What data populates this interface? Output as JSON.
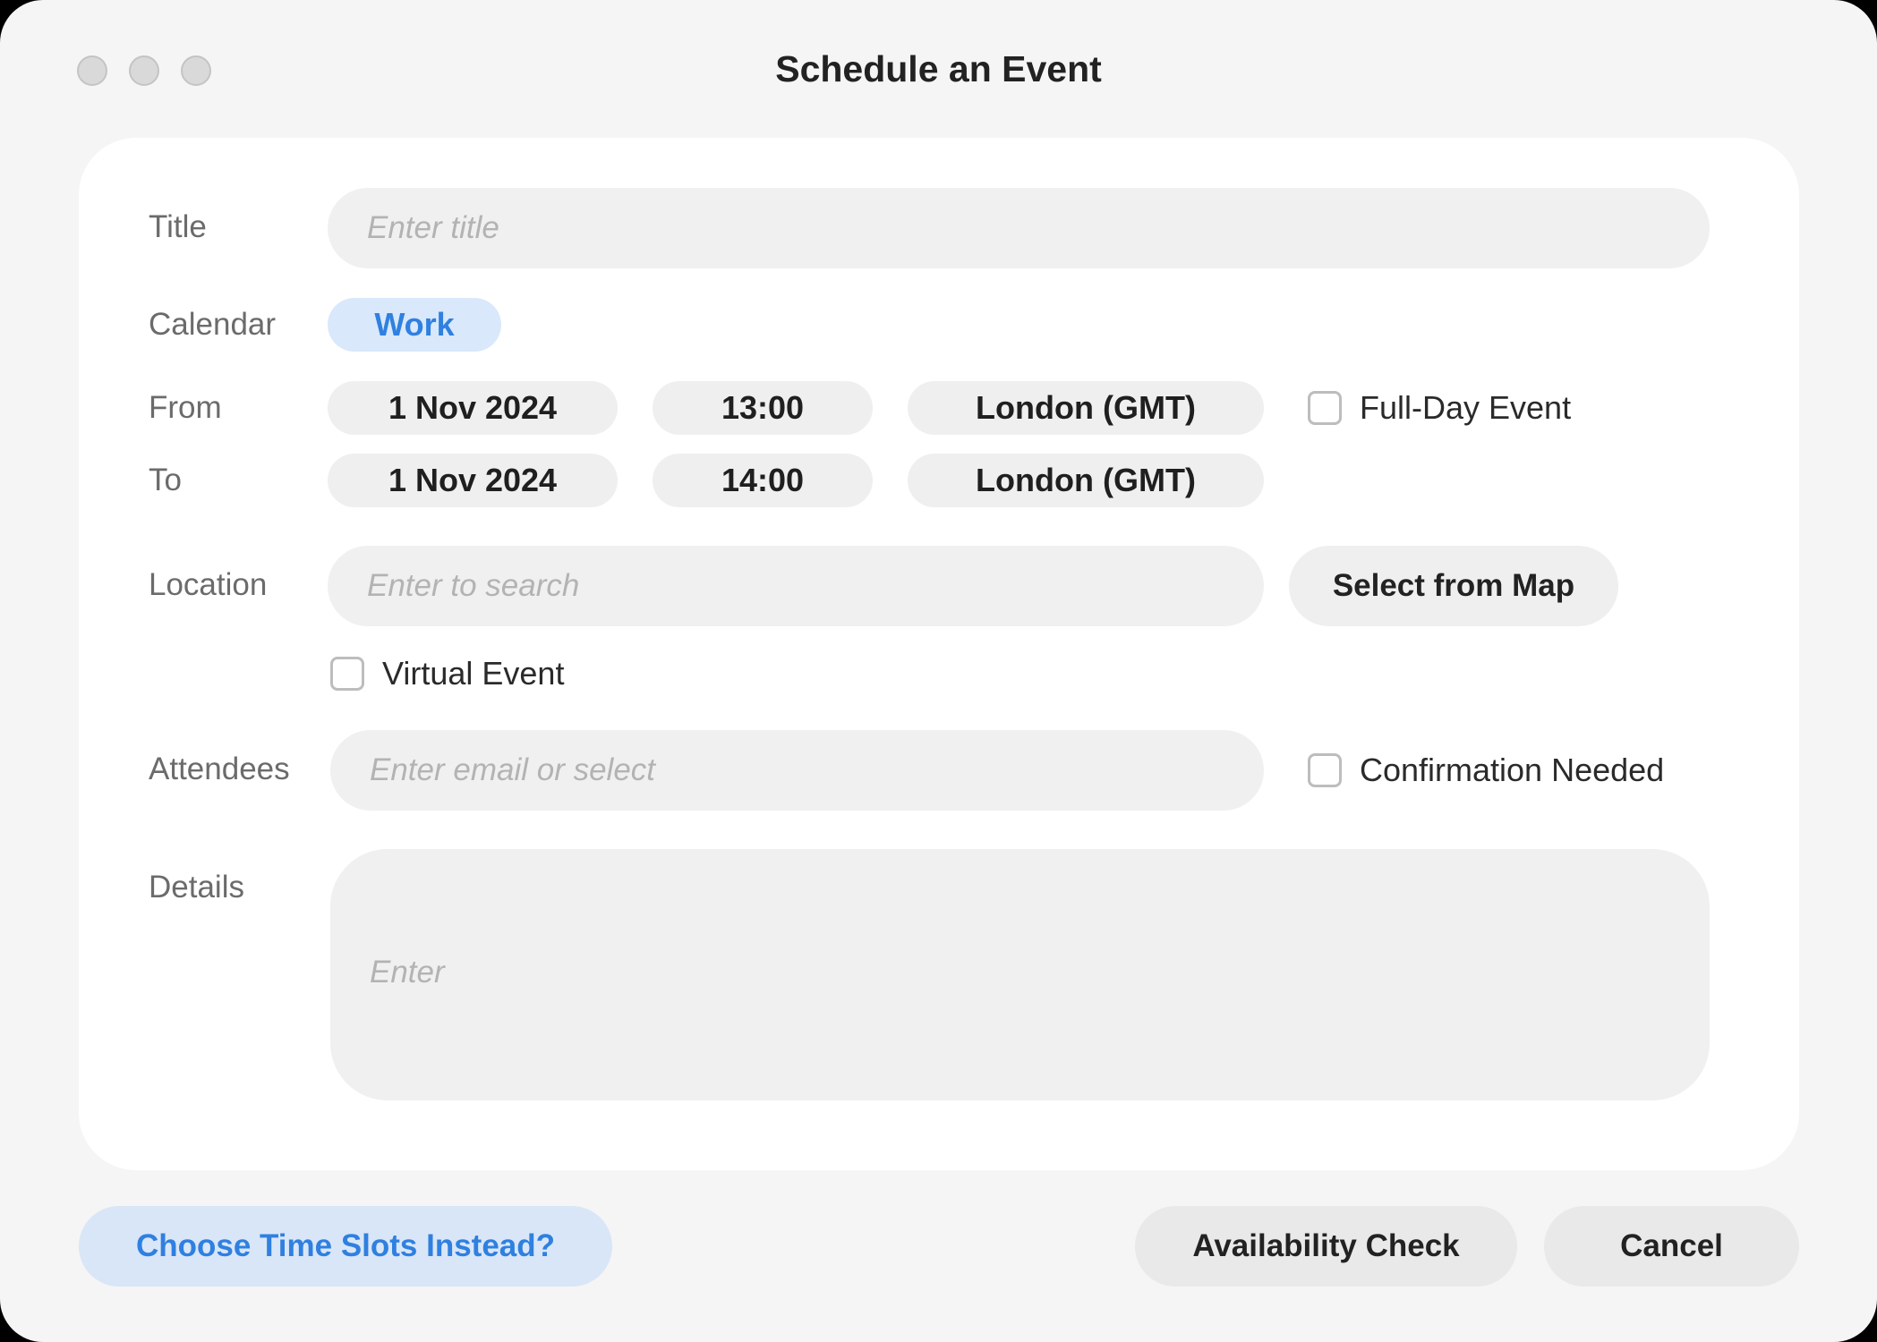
{
  "window": {
    "title": "Schedule an Event"
  },
  "form": {
    "title": {
      "label": "Title",
      "placeholder": "Enter title"
    },
    "calendar": {
      "label": "Calendar",
      "value": "Work"
    },
    "from": {
      "label": "From",
      "date": "1 Nov 2024",
      "time": "13:00",
      "timezone": "London (GMT)"
    },
    "to": {
      "label": "To",
      "date": "1 Nov 2024",
      "time": "14:00",
      "timezone": "London (GMT)"
    },
    "full_day": {
      "label": "Full-Day Event",
      "checked": false
    },
    "location": {
      "label": "Location",
      "placeholder": "Enter to search",
      "map_button": "Select from Map"
    },
    "virtual": {
      "label": "Virtual Event",
      "checked": false
    },
    "attendees": {
      "label": "Attendees",
      "placeholder": "Enter email or select"
    },
    "confirmation": {
      "label": "Confirmation Needed",
      "checked": false
    },
    "details": {
      "label": "Details",
      "placeholder": "Enter"
    }
  },
  "footer": {
    "time_slots": "Choose Time Slots Instead?",
    "availability": "Availability Check",
    "cancel": "Cancel"
  },
  "colors": {
    "accent": "#2f80e0",
    "accent_bg": "#d9e8fb",
    "field_bg": "#f0f0f0"
  }
}
